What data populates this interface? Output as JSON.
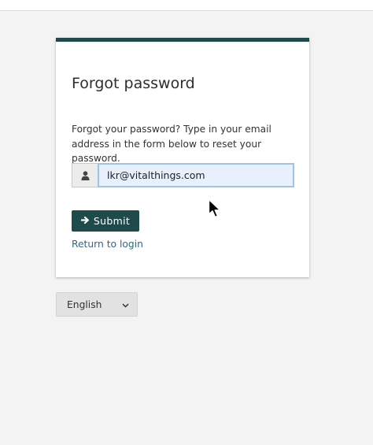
{
  "form": {
    "title": "Forgot password",
    "description": "Forgot your password? Type in your email address in the form below to reset your password.",
    "email": {
      "value": "lkr@vitalthings.com",
      "icon": "user-icon"
    },
    "submit_label": "Submit",
    "submit_icon": "arrow-right-icon",
    "return_link": "Return to login"
  },
  "language": {
    "selected": "English",
    "icon": "chevron-down-icon"
  },
  "colors": {
    "accent": "#1f4a4c",
    "link": "#2a6a8e",
    "input_bg": "#e8f0fe",
    "input_border": "#9ec3e6",
    "page_bg": "#f3f3f3"
  }
}
